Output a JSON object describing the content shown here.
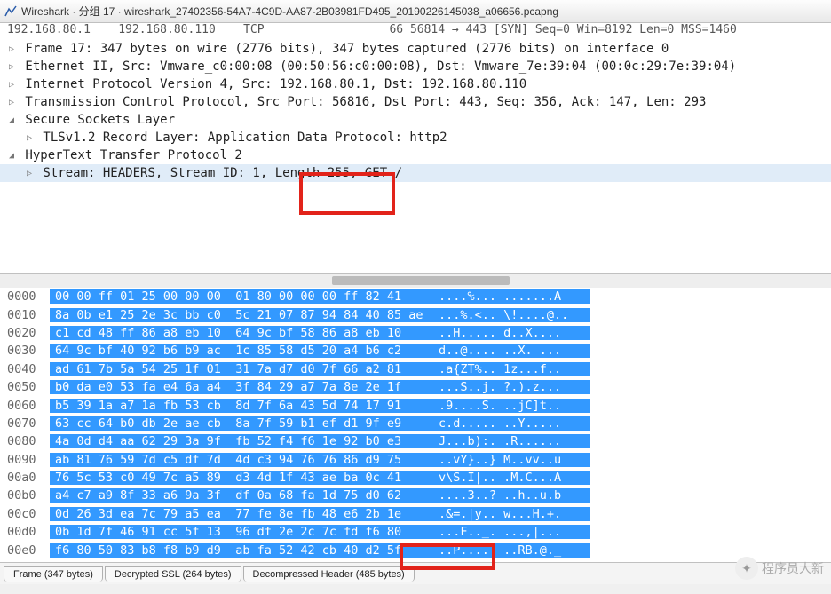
{
  "window": {
    "title": "Wireshark · 分组 17 · wireshark_27402356-54A7-4C9D-AA87-2B03981FD495_20190226145038_a06656.pcapng"
  },
  "packet_row": "192.168.80.1    192.168.80.110    TCP                  66 56814 → 443 [SYN] Seq=0 Win=8192 Len=0 MSS=1460",
  "tree": [
    {
      "toggle": "▷",
      "indent": 0,
      "text": "Frame 17: 347 bytes on wire (2776 bits), 347 bytes captured (2776 bits) on interface 0"
    },
    {
      "toggle": "▷",
      "indent": 0,
      "text": "Ethernet II, Src: Vmware_c0:00:08 (00:50:56:c0:00:08), Dst: Vmware_7e:39:04 (00:0c:29:7e:39:04)"
    },
    {
      "toggle": "▷",
      "indent": 0,
      "text": "Internet Protocol Version 4, Src: 192.168.80.1, Dst: 192.168.80.110"
    },
    {
      "toggle": "▷",
      "indent": 0,
      "text": "Transmission Control Protocol, Src Port: 56816, Dst Port: 443, Seq: 356, Ack: 147, Len: 293"
    },
    {
      "toggle": "◢",
      "indent": 0,
      "text": "Secure Sockets Layer"
    },
    {
      "toggle": "▷",
      "indent": 1,
      "text": "TLSv1.2 Record Layer: Application Data Protocol: http2"
    },
    {
      "toggle": "◢",
      "indent": 0,
      "text": "HyperText Transfer Protocol 2"
    },
    {
      "toggle": "▷",
      "indent": 1,
      "text": "Stream: HEADERS, Stream ID: 1, Length 255, GET /",
      "sel": true
    }
  ],
  "hex": [
    {
      "off": "0000",
      "b": "00 00 ff 01 25 00 00 00  01 80 00 00 00 ff 82 41",
      "a": "....%... .......A"
    },
    {
      "off": "0010",
      "b": "8a 0b e1 25 2e 3c bb c0  5c 21 07 87 94 84 40 85 ae",
      "a": "...%.<.. \\!....@.."
    },
    {
      "off": "0020",
      "b": "c1 cd 48 ff 86 a8 eb 10  64 9c bf 58 86 a8 eb 10",
      "a": "..H..... d..X...."
    },
    {
      "off": "0030",
      "b": "64 9c bf 40 92 b6 b9 ac  1c 85 58 d5 20 a4 b6 c2",
      "a": "d..@.... ..X. ..."
    },
    {
      "off": "0040",
      "b": "ad 61 7b 5a 54 25 1f 01  31 7a d7 d0 7f 66 a2 81",
      "a": ".a{ZT%.. 1z...f.."
    },
    {
      "off": "0050",
      "b": "b0 da e0 53 fa e4 6a a4  3f 84 29 a7 7a 8e 2e 1f",
      "a": "...S..j. ?.).z..."
    },
    {
      "off": "0060",
      "b": "b5 39 1a a7 1a fb 53 cb  8d 7f 6a 43 5d 74 17 91",
      "a": ".9....S. ..jC]t.."
    },
    {
      "off": "0070",
      "b": "63 cc 64 b0 db 2e ae cb  8a 7f 59 b1 ef d1 9f e9",
      "a": "c.d..... ..Y....."
    },
    {
      "off": "0080",
      "b": "4a 0d d4 aa 62 29 3a 9f  fb 52 f4 f6 1e 92 b0 e3",
      "a": "J...b):. .R......"
    },
    {
      "off": "0090",
      "b": "ab 81 76 59 7d c5 df 7d  4d c3 94 76 76 86 d9 75",
      "a": "..vY}..} M..vv..u"
    },
    {
      "off": "00a0",
      "b": "76 5c 53 c0 49 7c a5 89  d3 4d 1f 43 ae ba 0c 41",
      "a": "v\\S.I|.. .M.C...A"
    },
    {
      "off": "00b0",
      "b": "a4 c7 a9 8f 33 a6 9a 3f  df 0a 68 fa 1d 75 d0 62",
      "a": "....3..? ..h..u.b"
    },
    {
      "off": "00c0",
      "b": "0d 26 3d ea 7c 79 a5 ea  77 fe 8e fb 48 e6 2b 1e",
      "a": ".&=.|y.. w...H.+."
    },
    {
      "off": "00d0",
      "b": "0b 1d 7f 46 91 cc 5f 13  96 df 2e 2c 7c fd f6 80",
      "a": "...F.._. ...,|..."
    },
    {
      "off": "00e0",
      "b": "f6 80 50 83 b8 f8 b9 d9  ab fa 52 42 cb 40 d2 5f",
      "a": "..P..... ..RB.@._"
    }
  ],
  "tabs": [
    {
      "label": "Frame (347 bytes)"
    },
    {
      "label": "Decrypted SSL (264 bytes)"
    },
    {
      "label": "Decompressed Header (485 bytes)"
    }
  ],
  "watermark": "程序员大新"
}
